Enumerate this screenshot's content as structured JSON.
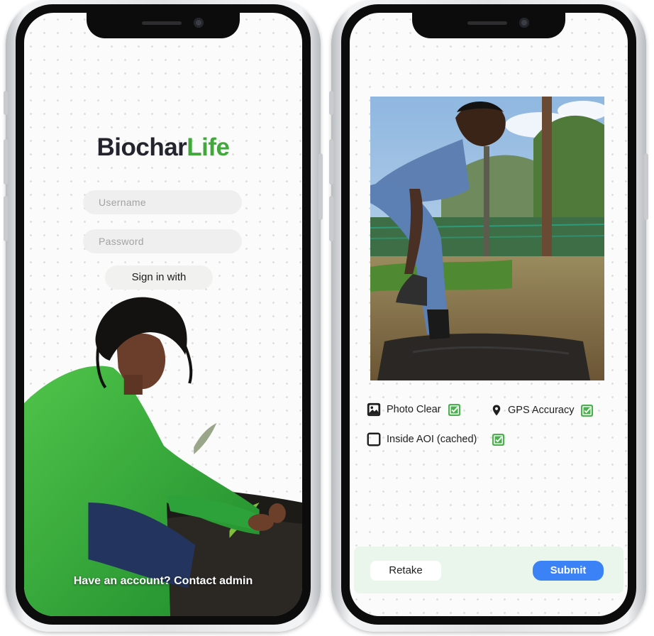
{
  "login_screen": {
    "brand": {
      "part1": "Biochar",
      "part2": "Life"
    },
    "username_placeholder": "Username",
    "password_placeholder": "Password",
    "signin_label": "Sign in with",
    "footer_text": "Have an account? Contact admin"
  },
  "capture_screen": {
    "checks": [
      {
        "label": "Photo Clear",
        "icon": "image-icon",
        "passed": true
      },
      {
        "label": "GPS Accuracy",
        "icon": "location-pin-icon",
        "passed": true
      },
      {
        "label": "Inside AOI (cached)",
        "icon": "square-outline-icon",
        "passed": true
      }
    ],
    "retake_label": "Retake",
    "submit_label": "Submit"
  },
  "colors": {
    "brand_green": "#42a83c",
    "brand_dark": "#24242e",
    "check_green": "#4caf50",
    "submit_blue": "#3a82f6",
    "action_bar_bg": "#eaf6eb"
  }
}
